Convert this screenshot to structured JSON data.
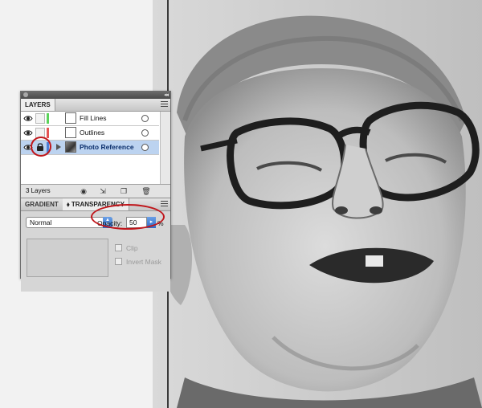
{
  "layers_panel": {
    "tab_label": "LAYERS",
    "layers": [
      {
        "name": "Fill Lines",
        "color": "#5ad35a",
        "locked": false,
        "selected": false
      },
      {
        "name": "Outlines",
        "color": "#e45454",
        "locked": false,
        "selected": false
      },
      {
        "name": "Photo Reference",
        "color": "#4a7fd6",
        "locked": true,
        "selected": true
      }
    ],
    "layer_count": "3 Layers"
  },
  "transparency_panel": {
    "tabs": [
      "GRADIENT",
      "TRANSPARENCY"
    ],
    "blend_mode": "Normal",
    "opacity_label": "Opacity:",
    "opacity_value": "50",
    "opacity_unit": "%",
    "clip_label": "Clip",
    "invert_mask_label": "Invert Mask"
  },
  "colors": {
    "highlight_ring": "#c0161b",
    "selection": "#bcd3f0",
    "accent": "#2f6cc8"
  }
}
